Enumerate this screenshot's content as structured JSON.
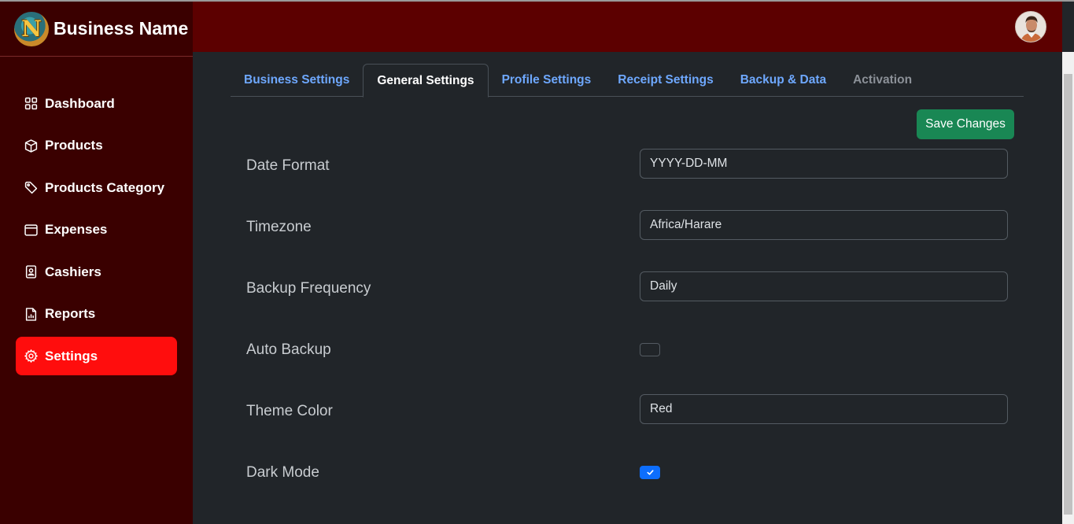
{
  "sidebar": {
    "brand_name": "Business Name",
    "logo_letter": "N",
    "items": [
      {
        "label": "Dashboard",
        "icon": "grid-icon"
      },
      {
        "label": "Products",
        "icon": "box-icon"
      },
      {
        "label": "Products Category",
        "icon": "tag-icon"
      },
      {
        "label": "Expenses",
        "icon": "window-icon"
      },
      {
        "label": "Cashiers",
        "icon": "person-badge-icon"
      },
      {
        "label": "Reports",
        "icon": "report-icon"
      },
      {
        "label": "Settings",
        "icon": "gear-icon",
        "active": true
      }
    ]
  },
  "header": {
    "avatar": "user-avatar"
  },
  "tabs": [
    {
      "label": "Business Settings",
      "state": "link"
    },
    {
      "label": "General Settings",
      "state": "active"
    },
    {
      "label": "Profile Settings",
      "state": "link"
    },
    {
      "label": "Receipt Settings",
      "state": "link"
    },
    {
      "label": "Backup & Data",
      "state": "link"
    },
    {
      "label": "Activation",
      "state": "disabled"
    }
  ],
  "save_button": "Save Changes",
  "settings": {
    "date_format": {
      "label": "Date Format",
      "value": "YYYY-DD-MM"
    },
    "timezone": {
      "label": "Timezone",
      "value": "Africa/Harare"
    },
    "backup_frequency": {
      "label": "Backup Frequency",
      "value": "Daily"
    },
    "auto_backup": {
      "label": "Auto Backup",
      "checked": false
    },
    "theme_color": {
      "label": "Theme Color",
      "value": "Red"
    },
    "dark_mode": {
      "label": "Dark Mode",
      "checked": true
    }
  },
  "colors": {
    "sidebar_bg": "#3a0000",
    "header_bg": "#5c0000",
    "active_nav": "#ff0d0d",
    "save_button": "#198754",
    "tab_link": "#6ea8fe",
    "checkbox_checked": "#0d6efd"
  }
}
